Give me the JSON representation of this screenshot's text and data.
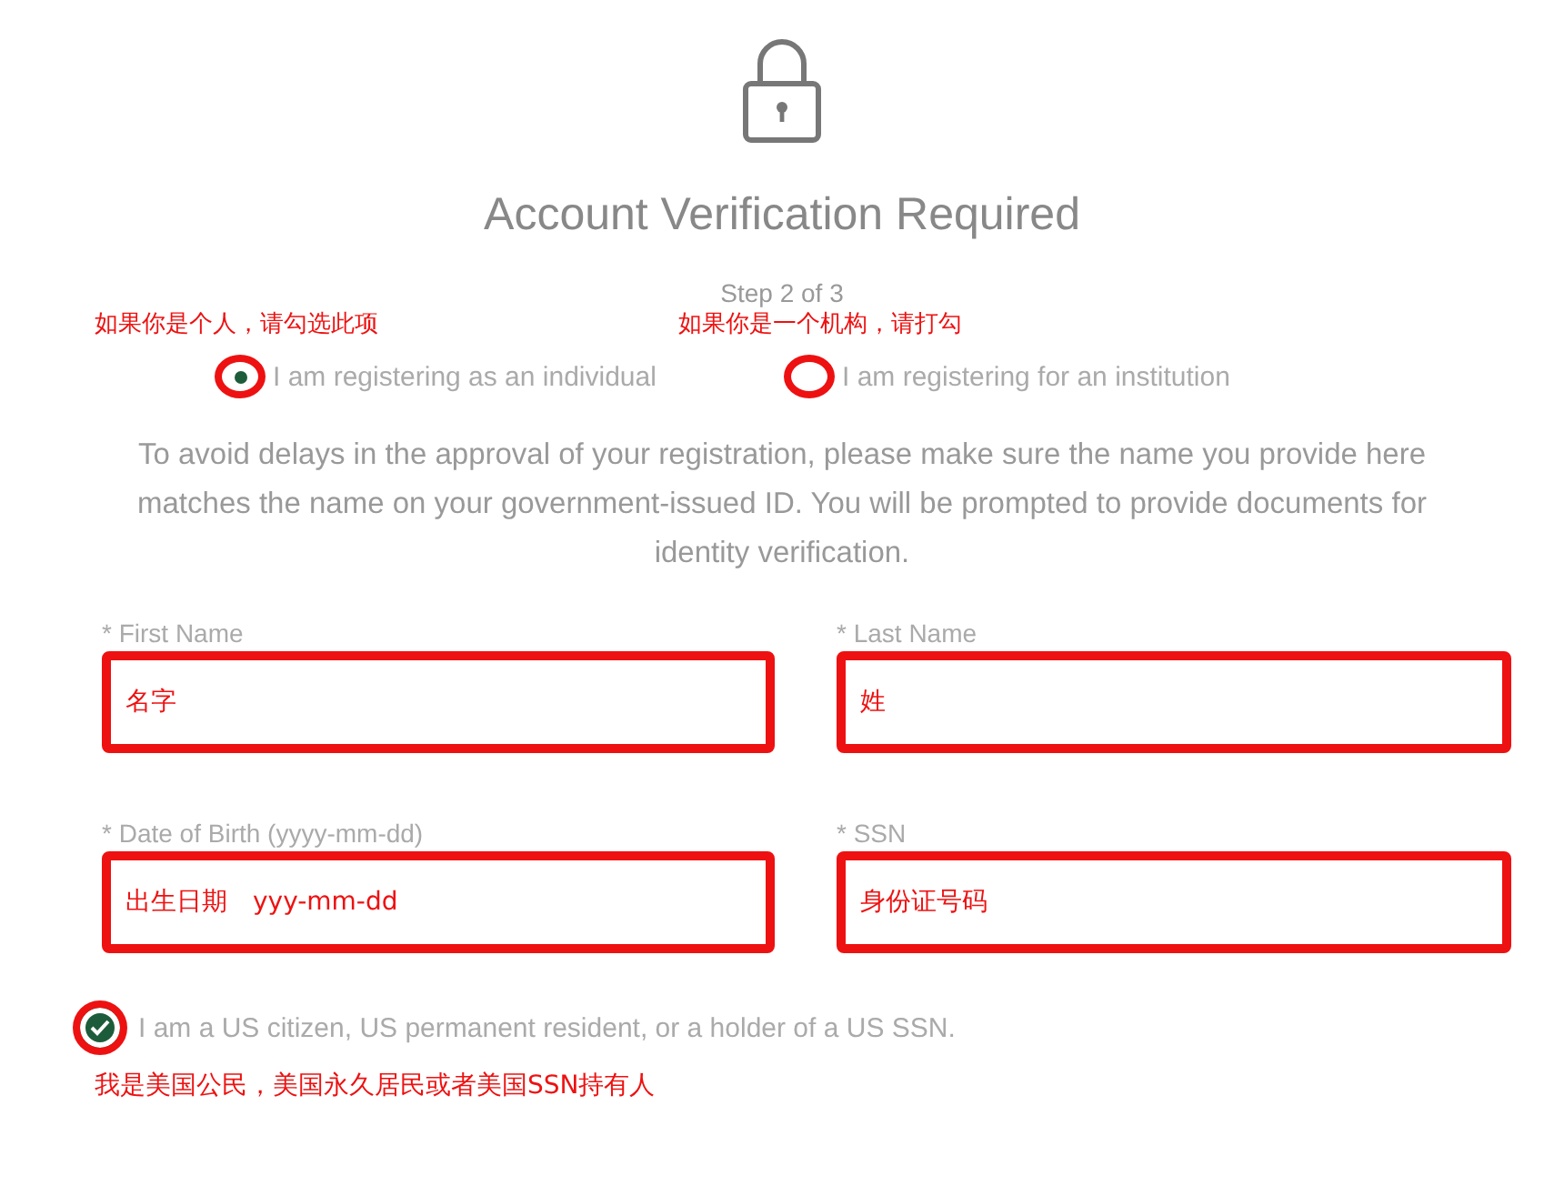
{
  "header": {
    "title": "Account Verification Required",
    "step": "Step 2 of 3"
  },
  "registration_types": [
    {
      "annotation": "如果你是个人，请勾选此项",
      "label": "I am registering as an individual",
      "selected": true
    },
    {
      "annotation": "如果你是一个机构，请打勾",
      "label": "I am registering for an institution",
      "selected": false
    }
  ],
  "notice": "To avoid delays in the approval of your registration, please make sure the name you provide here matches the name on your government-issued ID. You will be prompted to provide documents for identity verification.",
  "fields": [
    {
      "label": "* First Name",
      "value": "名字"
    },
    {
      "label": "* Last Name",
      "value": "姓"
    },
    {
      "label": "* Date of Birth (yyyy-mm-dd)",
      "value": "出生日期　yyy-mm-dd"
    },
    {
      "label": "* SSN",
      "value": "身份证号码"
    }
  ],
  "citizen_check": {
    "label": "I am a US citizen, US permanent resident, or a holder of a US SSN.",
    "checked": true,
    "annotation": "我是美国公民，美国永久居民或者美国SSN持有人"
  }
}
